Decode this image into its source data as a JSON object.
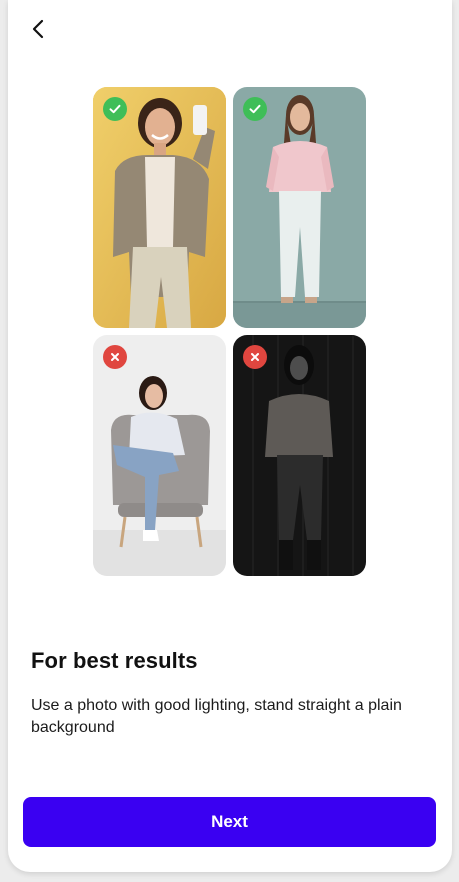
{
  "header": {
    "back_icon": "chevron-left-icon"
  },
  "examples": [
    {
      "status": "good",
      "icon": "check-icon",
      "scene": "smiling woman taking selfie on yellow background"
    },
    {
      "status": "good",
      "icon": "check-icon",
      "scene": "woman standing straight on teal background"
    },
    {
      "status": "bad",
      "icon": "x-icon",
      "scene": "woman sitting in armchair"
    },
    {
      "status": "bad",
      "icon": "x-icon",
      "scene": "woman standing in dark low-light room"
    }
  ],
  "tips": {
    "title": "For best results",
    "description": "Use a photo with good lighting, stand straight a plain background"
  },
  "footer": {
    "next_label": "Next"
  },
  "colors": {
    "primary": "#3a00f2",
    "good": "#3fbe58",
    "bad": "#e0463f"
  }
}
